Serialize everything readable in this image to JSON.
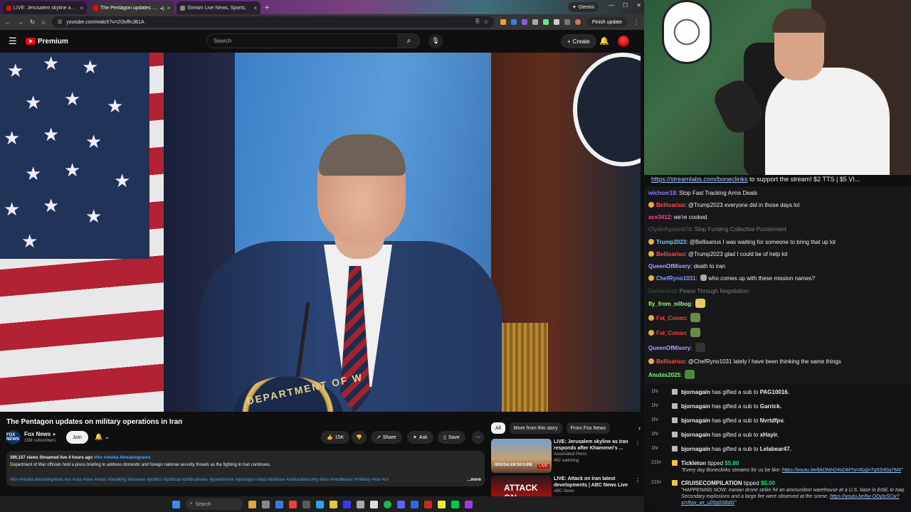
{
  "tabs": [
    {
      "label": "LIVE: Jerusalem skyline as Iran",
      "color": "#ff0000",
      "active": false
    },
    {
      "label": "The Pentagon updates on m",
      "color": "#ff0000",
      "active": true
    },
    {
      "label": "Stream Live News, Sports,",
      "color": "#888888",
      "active": false
    }
  ],
  "gemini_label": "Gemini",
  "address": {
    "url": "youtube.com/watch?v=2I3vffnJB1A",
    "finish_update": "Finish update"
  },
  "yt": {
    "logo_label": "Premium",
    "search_placeholder": "Search",
    "create_label": "Create"
  },
  "video": {
    "title": "The Pentagon updates on military operations in Iran",
    "podium_text": "DEPARTMENT OF W",
    "channel": {
      "name": "Fox News",
      "subscribers": "15M subscribers",
      "avatar_text": "FOX NEWS",
      "join_label": "Join"
    },
    "actions": {
      "likes": "15K",
      "share": "Share",
      "ask": "Ask",
      "save": "Save"
    },
    "description": {
      "meta": "390,157 views  Streamed live 4 hours ago",
      "meta_tags": "#fox #media #breakingnews",
      "text": "Department of War officials hold a press briefing to address domestic and foreign national security threats as the fighting in Iran continues.",
      "tags": "#fox #media #breakingnews #us #usa #new #news #breaking #foxnews #politics #political #politicalnews #government #pentagon #dod #defense #nationalsecurity #iran #middleeast #military #war #co",
      "more": "...more"
    }
  },
  "related": {
    "chips": [
      "All",
      "More from this story",
      "From Fox News"
    ],
    "items": [
      {
        "title": "LIVE: Jerusalem skyline as Iran responds after Khamenei's ...",
        "channel": "Associated Press",
        "meta": "462 watching",
        "live": "LIVE",
        "thumb_text": "JERUSALEM SKYLINE"
      },
      {
        "title": "LIVE: Attack on Iran latest developments | ABC News Live",
        "channel": "ABC News",
        "meta": "",
        "live": "",
        "thumb_text": "ATTACK ON"
      }
    ]
  },
  "ticker": {
    "link": "https://streamlabs.com/boneclinks",
    "text": " to support the stream! $2 TTS | $5 VI..."
  },
  "chat": [
    {
      "user": "wichser18",
      "color": "#8a7cff",
      "badge": false,
      "text": "Stop Fast Tracking Arms Deals"
    },
    {
      "user": "Bellisarius",
      "color": "#ff4f4f",
      "badge": true,
      "text": "@Trump2023 everyone did in those days lol"
    },
    {
      "user": "ace3412",
      "color": "#ff3b9a",
      "badge": false,
      "text": "we're cooked"
    },
    {
      "user": "ClydeAguon670",
      "color": "#8a8a8a",
      "badge": false,
      "text": "Stop Funding Collective Punishment",
      "dim": true
    },
    {
      "user": "Trump2023",
      "color": "#6ec6ff",
      "badge": true,
      "text": "@Bellisarius I was waiting for someone to bring that up lol"
    },
    {
      "user": "Bellisarius",
      "color": "#ff4f4f",
      "badge": true,
      "text": "@Trump2023 glad I could be of help lol"
    },
    {
      "user": "QueenOfMisery",
      "color": "#b0a0ff",
      "badge": false,
      "text": "death to iran"
    },
    {
      "user": "ChefRyno1031",
      "color": "#6ea8ff",
      "badge": true,
      "text": "who comes up with these mission names?"
    },
    {
      "user": "Darkariest",
      "color": "#3a8a4a",
      "badge": false,
      "text": "Peace Through Negotiation",
      "dim": true
    },
    {
      "user": "fly_from_nilbog",
      "color": "#9eff6e",
      "badge": false,
      "text": "",
      "emote": true
    },
    {
      "user": "Fat_Conan",
      "color": "#ff3b3b",
      "badge": true,
      "text": "",
      "emote": true
    },
    {
      "user": "Fat_Conan",
      "color": "#ff3b3b",
      "badge": true,
      "text": "",
      "emote": true
    },
    {
      "user": "QueenOfMisery",
      "color": "#b0a0ff",
      "badge": false,
      "text": "",
      "emote": true
    },
    {
      "user": "Bellisarius",
      "color": "#ff4f4f",
      "badge": true,
      "text": "@ChefRyno1031 lately I have been thinking the same things"
    },
    {
      "user": "Anubis2025",
      "color": "#6eff6e",
      "badge": false,
      "text": "",
      "emote": true
    }
  ],
  "events": [
    {
      "time": "1hr",
      "user": "bjornagain",
      "action": "has gifted a sub to",
      "target": "PAG10016."
    },
    {
      "time": "1hr",
      "user": "bjornagain",
      "action": "has gifted a sub to",
      "target": "Garrick."
    },
    {
      "time": "1hr",
      "user": "bjornagain",
      "action": "has gifted a sub to",
      "target": "Nvrtdfpv."
    },
    {
      "time": "1hr",
      "user": "bjornagain",
      "action": "has gifted a sub to",
      "target": "xHayir."
    },
    {
      "time": "1hr",
      "user": "bjornagain",
      "action": "has gifted a sub to",
      "target": "Lelabear47."
    },
    {
      "time": "21hr",
      "user": "Tickleton",
      "action": "tipped",
      "target": "$5.00",
      "note": "\"Every day Boneclinks streams for us be like: ",
      "note_link": "https://youtu.be/bkDhtH24oDM?si=RzjjnTg5SrEjq7M4",
      "note_end": "\""
    },
    {
      "time": "21hr",
      "user": "CRUISECOMPILATION",
      "action": "tipped",
      "target": "$5.00",
      "note": "\"HAPPENING NOW: Iranian drone strike hit an ammunition warehouse at a U.S. base in Erbil, in Iraq. Secondary explosions and a large fire were observed at the scene. ",
      "note_link": "https://youtu.be/by-ODytxSCw?si=Rps_wr_u05g0SBdG",
      "note_end": "\""
    }
  ],
  "taskbar": {
    "search_label": "Search"
  }
}
